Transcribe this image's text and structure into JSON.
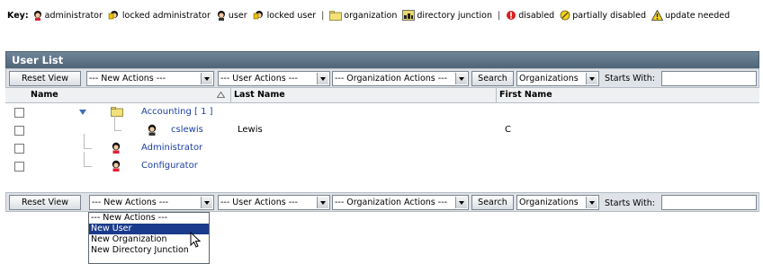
{
  "key": {
    "label": "Key:",
    "items": [
      {
        "label": "administrator",
        "icon": "administrator-icon"
      },
      {
        "label": "locked administrator",
        "icon": "locked-administrator-icon"
      },
      {
        "label": "user",
        "icon": "user-icon"
      },
      {
        "label": "locked user",
        "icon": "locked-user-icon"
      },
      {
        "label": "organization",
        "icon": "organization-folder-icon"
      },
      {
        "label": "directory junction",
        "icon": "directory-junction-icon"
      },
      {
        "label": "disabled",
        "icon": "disabled-icon"
      },
      {
        "label": "partially disabled",
        "icon": "partially-disabled-icon"
      },
      {
        "label": "update needed",
        "icon": "update-needed-icon"
      }
    ],
    "separator": "|"
  },
  "panel": {
    "title": "User List"
  },
  "toolbar": {
    "reset_label": "Reset View",
    "new_actions": "--- New Actions ---",
    "user_actions": "--- User Actions ---",
    "org_actions": "--- Organization Actions ---",
    "search_label": "Search",
    "scope": "Organizations",
    "starts_with_label": "Starts With:",
    "starts_with_value": ""
  },
  "table": {
    "columns": {
      "name": "Name",
      "last_name": "Last Name",
      "first_name": "First Name"
    },
    "rows": [
      {
        "name": "Accounting [ 1 ]",
        "last_name": "",
        "first_name": ""
      },
      {
        "name": "cslewis",
        "last_name": "Lewis",
        "first_name": "C"
      },
      {
        "name": "Administrator",
        "last_name": "",
        "first_name": ""
      },
      {
        "name": "Configurator",
        "last_name": "",
        "first_name": ""
      }
    ]
  },
  "dropdown": {
    "options": [
      "--- New Actions ---",
      "New User",
      "New Organization",
      "New Directory Junction"
    ],
    "highlighted": "New User"
  },
  "colors": {
    "title_bar": "#5a7083",
    "link": "#1b3fa4",
    "highlight": "#1a3b8b"
  }
}
